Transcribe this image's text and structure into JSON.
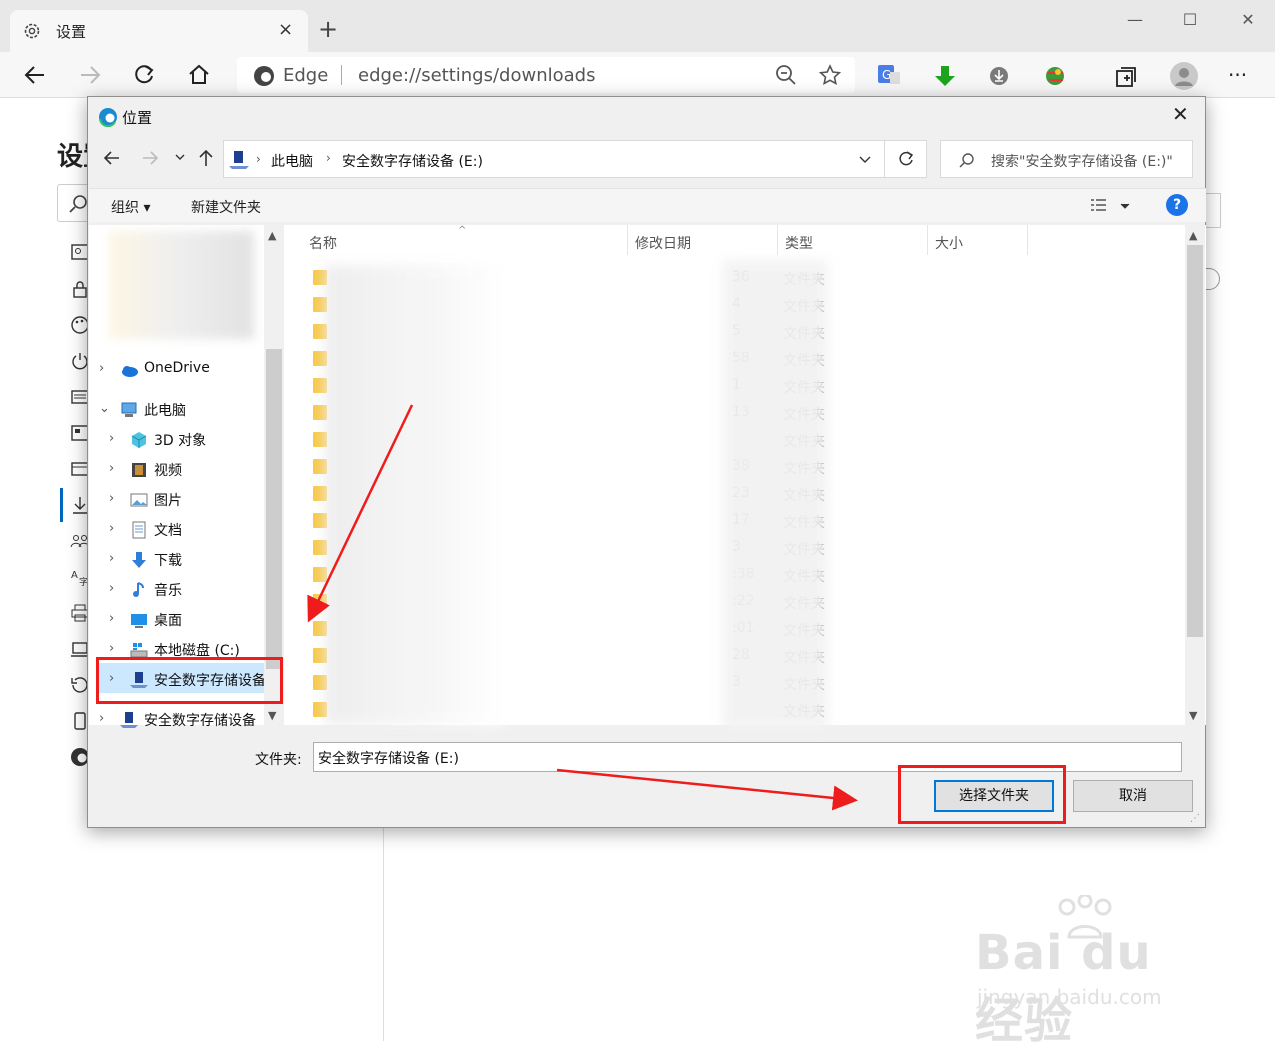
{
  "browser": {
    "tab_title": "设置",
    "tab_close": "×",
    "new_tab": "+",
    "window_controls": [
      "—",
      "☐",
      "✕"
    ],
    "address_brand": "Edge",
    "address_url": "edge://settings/downloads",
    "more_menu": "···"
  },
  "settings_page": {
    "title": "设置",
    "sidebar_icons": [
      "profile-icon",
      "lock-icon",
      "palette-icon",
      "power-icon",
      "start-page-icon",
      "newtab-icon",
      "sharing-icon",
      "download-icon",
      "family-icon",
      "languages-icon",
      "printer-icon",
      "system-icon",
      "reset-icon",
      "phone-icon",
      "edge-icon"
    ]
  },
  "dialog": {
    "title": "位置",
    "close": "✕",
    "breadcrumb": [
      "此电脑",
      "安全数字存储设备 (E:)"
    ],
    "search_placeholder": "搜索\"安全数字存储设备 (E:)\"",
    "organize_label": "组织",
    "new_folder_label": "新建文件夹",
    "help_label": "?",
    "nav_tree": [
      {
        "label": "OneDrive",
        "icon": "onedrive-icon",
        "level": 0
      },
      {
        "label": "此电脑",
        "icon": "pc-icon",
        "level": 0
      },
      {
        "label": "3D 对象",
        "icon": "3d-objects-icon",
        "level": 1
      },
      {
        "label": "视频",
        "icon": "video-icon",
        "level": 1
      },
      {
        "label": "图片",
        "icon": "pictures-icon",
        "level": 1
      },
      {
        "label": "文档",
        "icon": "documents-icon",
        "level": 1
      },
      {
        "label": "下载",
        "icon": "downloads-icon",
        "level": 1
      },
      {
        "label": "音乐",
        "icon": "music-icon",
        "level": 1
      },
      {
        "label": "桌面",
        "icon": "desktop-icon",
        "level": 1
      },
      {
        "label": "本地磁盘 (C:)",
        "icon": "drive-icon",
        "level": 1
      },
      {
        "label": "安全数字存储设备",
        "icon": "usb-drive-icon",
        "level": 1
      },
      {
        "label": "安全数字存储设备",
        "icon": "usb-drive-icon",
        "level": 0
      }
    ],
    "columns": [
      "名称",
      "修改日期",
      "类型",
      "大小"
    ],
    "rows": [
      {
        "date": "36",
        "type": "文件夹"
      },
      {
        "date": "4",
        "type": "文件夹"
      },
      {
        "date": "5",
        "type": "文件夹"
      },
      {
        "date": "58",
        "type": "文件夹"
      },
      {
        "date": "1",
        "type": "文件夹"
      },
      {
        "date": "13",
        "type": "文件夹"
      },
      {
        "date": "",
        "type": "文件夹"
      },
      {
        "date": "38",
        "type": "文件夹"
      },
      {
        "date": "23",
        "type": "文件夹"
      },
      {
        "date": "17",
        "type": "文件夹"
      },
      {
        "date": "3",
        "type": "文件夹"
      },
      {
        "date": ":38",
        "type": "文件夹"
      },
      {
        "date": ":22",
        "type": "文件夹"
      },
      {
        "date": ":01",
        "type": "文件夹"
      },
      {
        "date": "28",
        "type": "文件夹"
      },
      {
        "date": "3",
        "type": "文件夹"
      },
      {
        "date": "",
        "type": "文件夹"
      }
    ],
    "folder_label": "文件夹:",
    "folder_value": "安全数字存储设备 (E:)",
    "select_button": "选择文件夹",
    "cancel_button": "取消"
  },
  "watermark": {
    "main": "Bai du 经验",
    "sub": "jingyan.baidu.com"
  },
  "colors": {
    "annotation_red": "#ee1c1c",
    "selection_blue": "#cce8ff",
    "accent_blue": "#0078d7",
    "folder_yellow": "#f8c94a"
  }
}
